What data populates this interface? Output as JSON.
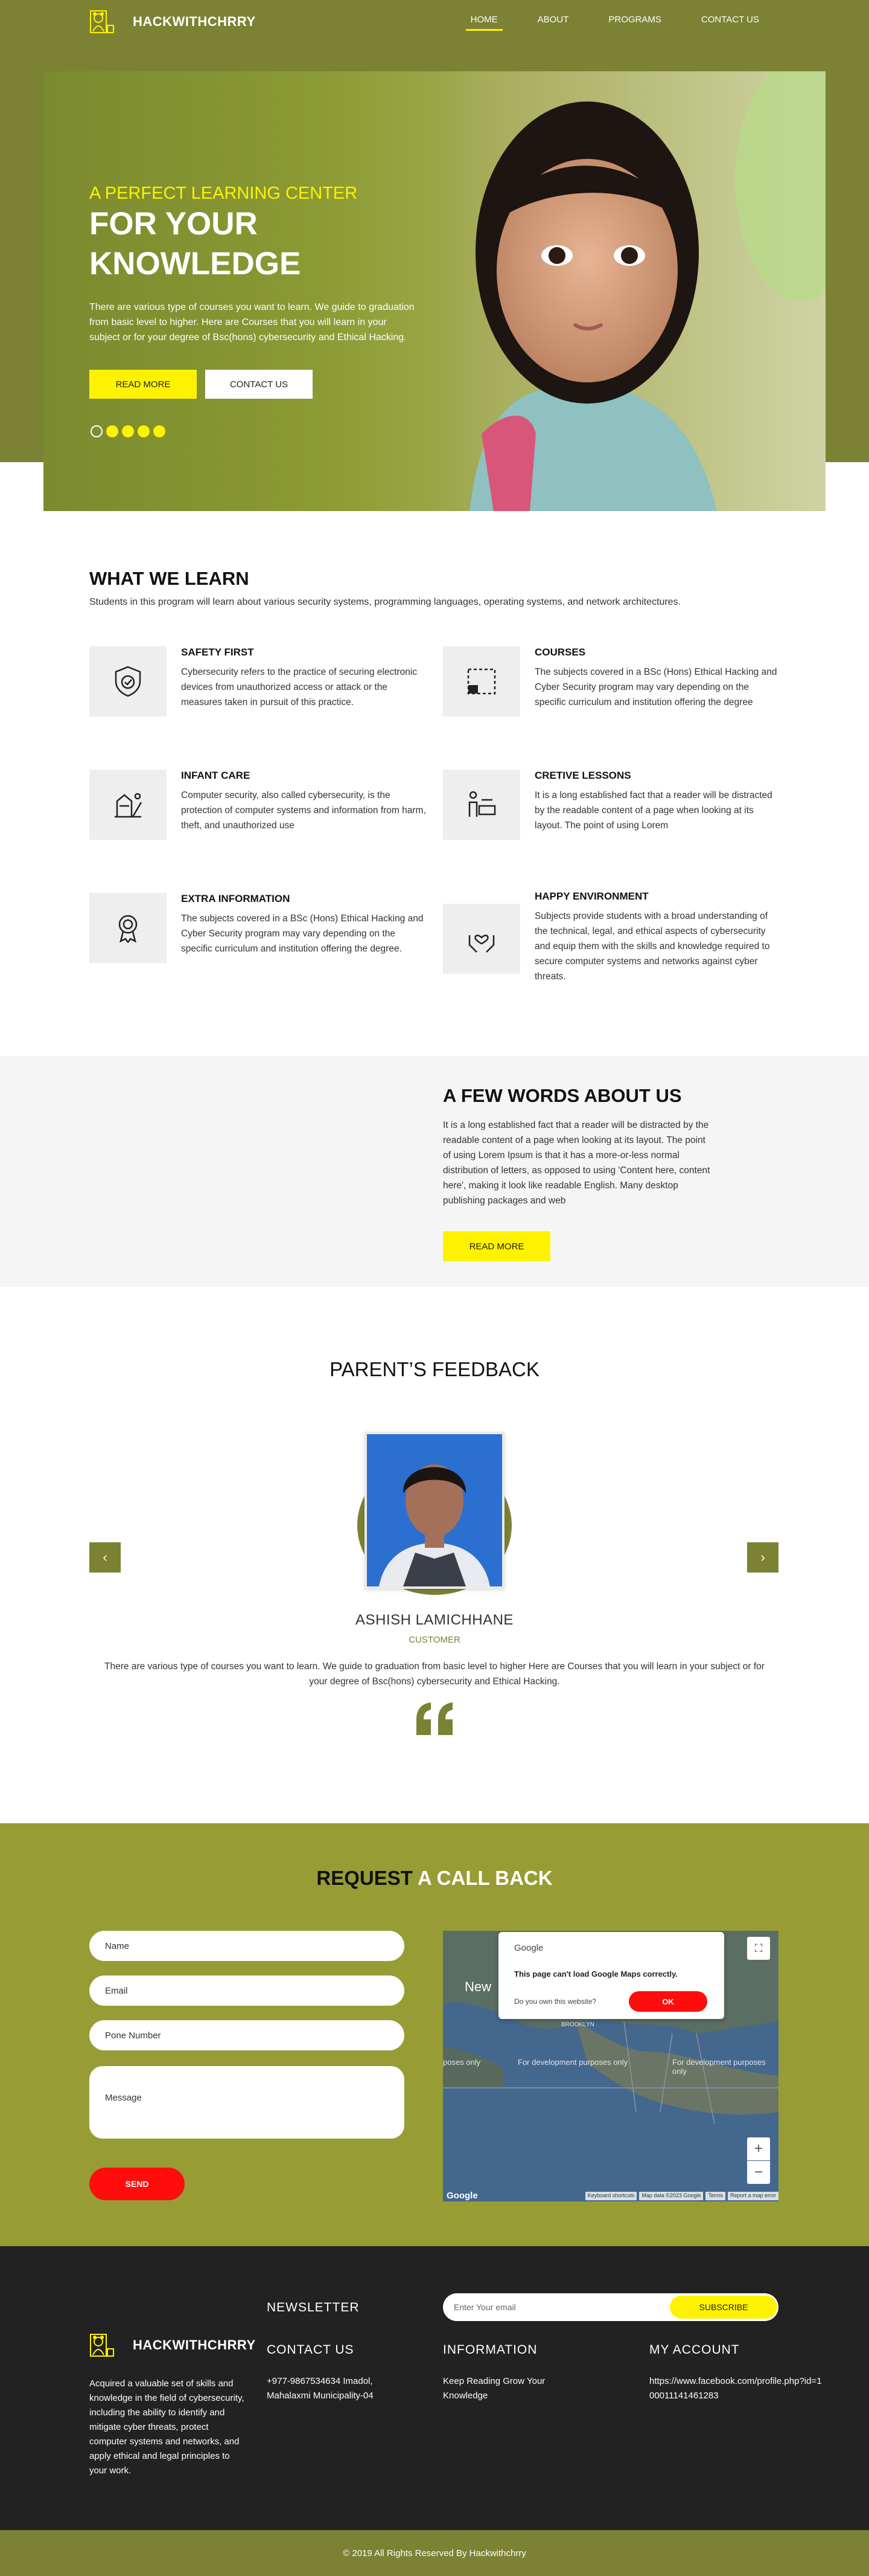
{
  "brand": {
    "name": "HACKWITHCHRRY"
  },
  "nav": [
    {
      "label": "HOME",
      "active": true
    },
    {
      "label": "ABOUT",
      "active": false
    },
    {
      "label": "PROGRAMS",
      "active": false
    },
    {
      "label": "CONTACT US",
      "active": false
    }
  ],
  "hero": {
    "subtitle": "A PERFECT LEARNING CENTER",
    "title": "FOR YOUR KNOWLEDGE",
    "text": "There are various type of courses you want to learn. We guide to graduation from basic level to higher. Here are Courses that you will learn in your subject or for your degree of Bsc(hons) cybersecurity and Ethical Hacking.",
    "read_more": "READ MORE",
    "contact_us": "CONTACT US",
    "slide_count": 5,
    "active_slide": 1
  },
  "learn": {
    "title": "WHAT WE LEARN",
    "subtitle": "Students in this program will learn about various security systems, programming languages, operating systems, and network architectures.",
    "features": [
      {
        "icon": "shield-check-icon",
        "title": "SAFETY FIRST",
        "text": "Cybersecurity refers to the practice of securing electronic devices from unauthorized access or attack or the measures taken in pursuit of this practice."
      },
      {
        "icon": "frame-icon",
        "title": "COURSES",
        "text": "The subjects covered in a BSc (Hons) Ethical Hacking and Cyber Security program may vary depending on the specific curriculum and institution offering the degree"
      },
      {
        "icon": "playground-icon",
        "title": "INFANT CARE",
        "text": "Computer security, also called cybersecurity, is the protection of computer systems and information from harm, theft, and unauthorized use"
      },
      {
        "icon": "lesson-icon",
        "title": "CRETIVE LESSONS",
        "text": "It is a long established fact that a reader will be distracted by the readable content of a page when looking at its layout. The point of using Lorem"
      },
      {
        "icon": "award-icon",
        "title": "EXTRA INFORMATION",
        "text": "The subjects covered in a BSc (Hons) Ethical Hacking and Cyber Security program may vary depending on the specific curriculum and institution offering the degree."
      },
      {
        "icon": "hands-heart-icon",
        "title": "HAPPY ENVIRONMENT",
        "text": "Subjects provide students with a broad understanding of the technical, legal, and ethical aspects of cybersecurity and equip them with the skills and knowledge required to secure computer systems and networks against cyber threats."
      }
    ]
  },
  "about": {
    "title": "A FEW WORDS ABOUT US",
    "text": "It is a long established fact that a reader will be distracted by the readable content of a page when looking at its layout. The point of using Lorem Ipsum is that it has a more-or-less normal distribution of letters, as opposed to using 'Content here, content here', making it look like readable English. Many desktop publishing packages and web",
    "button": "READ MORE"
  },
  "feedback": {
    "title": "PARENT’S FEEDBACK",
    "name": "ASHISH LAMICHHANE",
    "role": "CUSTOMER",
    "text": "There are various type of courses you want to learn. We guide to graduation from basic level to higher Here are Courses that you will learn in your subject or for your degree of Bsc(hons) cybersecurity and Ethical Hacking.",
    "prev": "‹",
    "next": "›"
  },
  "callback": {
    "title_dark": "REQUEST",
    "title_light": "A CALL BACK",
    "name_placeholder": "Name",
    "email_placeholder": "Email",
    "phone_placeholder": "Pone Number",
    "message_placeholder": "Message",
    "send": "SEND",
    "map": {
      "brand": "Google",
      "message": "This page can't load Google Maps correctly.",
      "question": "Do you own this website?",
      "ok": "OK",
      "zoom_in": "+",
      "zoom_out": "−",
      "fullscreen": "⛶",
      "google_logo": "Google",
      "footer": [
        "Keyboard shortcuts",
        "Map data ©2023 Google",
        "Terms",
        "Report a map error"
      ],
      "labels": [
        "New",
        "BROOKLYN",
        "For development purposes only",
        "For development purposes only",
        "poses only"
      ]
    }
  },
  "footer": {
    "newsletter": "NEWSLETTER",
    "email_placeholder": "Enter Your email",
    "subscribe": "SUBSCRIBE",
    "about": "Acquired a valuable set of skills and knowledge in the field of cybersecurity, including the ability to identify and mitigate cyber threats, protect computer systems and networks, and apply ethical and legal principles to your work.",
    "contact_title": "CONTACT US",
    "contact_text": "+977-9867534634 Imadol, Mahalaxmi Municipality-04",
    "info_title": "INFORMATION",
    "info_text": "Keep Reading Grow Your Knowledge",
    "account_title": "MY ACCOUNT",
    "account_text": "https://www.facebook.com/profile.php?id=100011141461283",
    "copyright": "© 2019 All Rights Reserved By Hackwithchrry"
  },
  "colors": {
    "olive": "#7b8233",
    "olive_light": "#979d34",
    "yellow": "#fff200",
    "red": "#ff0d0d",
    "dark": "#222222"
  }
}
